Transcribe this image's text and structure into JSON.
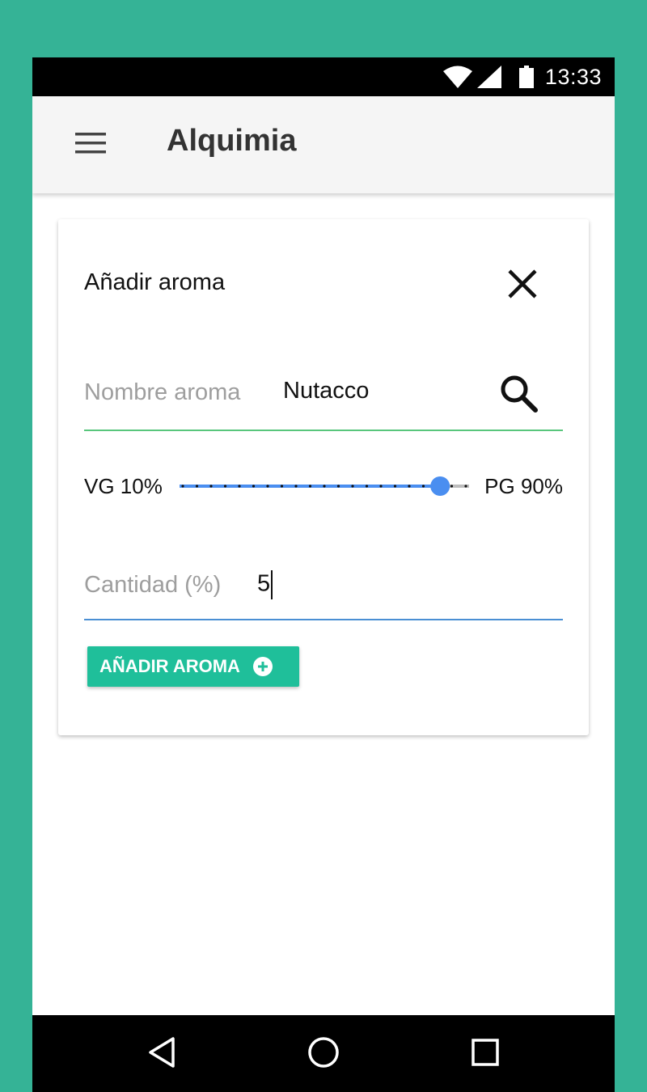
{
  "status_bar": {
    "time": "13:33"
  },
  "app_bar": {
    "title": "Alquimia"
  },
  "dialog": {
    "title": "Añadir aroma",
    "name_field": {
      "label": "Nombre aroma",
      "value": "Nutacco"
    },
    "ratio": {
      "vg_label": "VG 10%",
      "pg_label": "PG 90%",
      "pg_percent": 90
    },
    "quantity_field": {
      "label": "Cantidad (%)",
      "value": "5"
    },
    "add_button": {
      "label": "AÑADIR AROMA"
    }
  },
  "colors": {
    "background": "#35b396",
    "accent_button": "#1fbf9a",
    "slider": "#4a8ef0",
    "name_underline": "#58c67c",
    "quantity_underline": "#4a8fd4"
  }
}
